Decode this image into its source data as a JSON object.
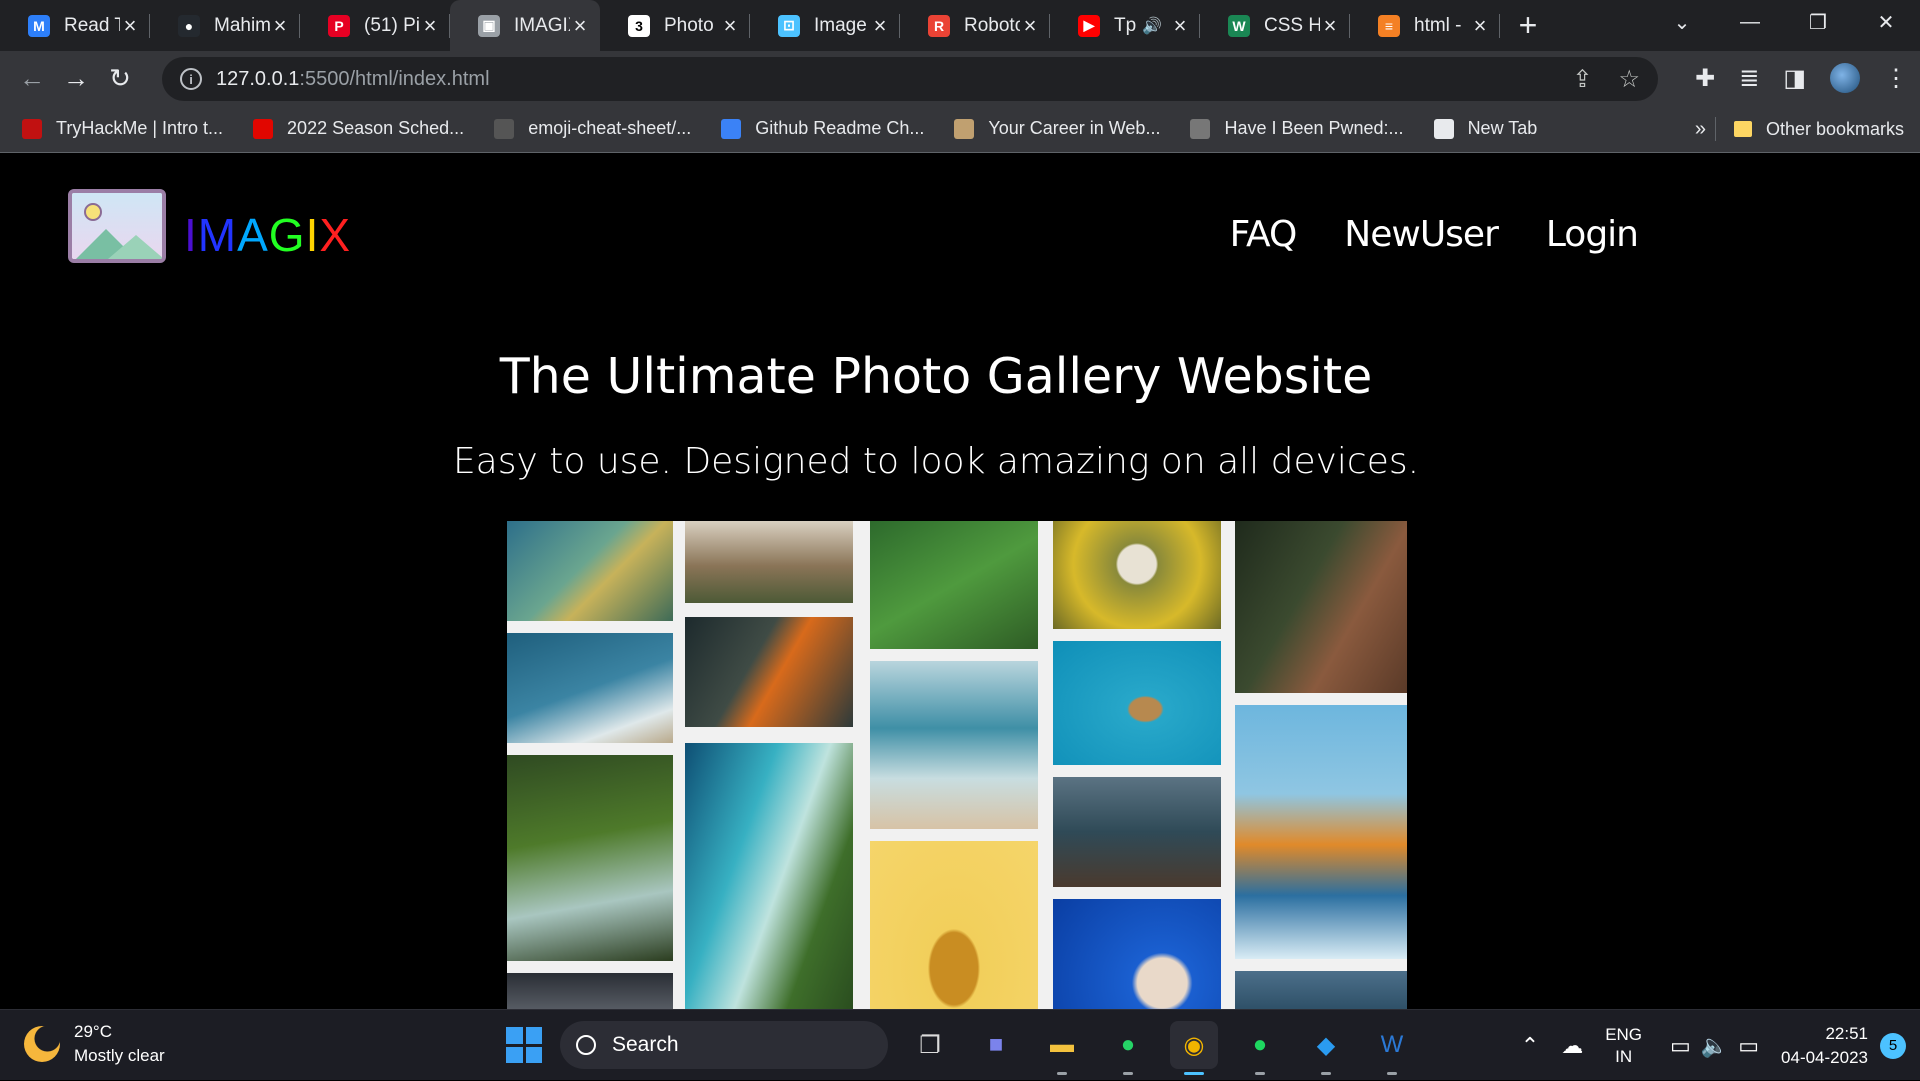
{
  "browser": {
    "tabs": [
      {
        "title": "Read T",
        "favicon": "gmail-icon",
        "color": "#2d7ff9",
        "glyph": "M"
      },
      {
        "title": "Mahim",
        "favicon": "github-icon",
        "color": "#24292f",
        "glyph": "●"
      },
      {
        "title": "(51) Pi",
        "favicon": "pinterest-icon",
        "color": "#e60023",
        "glyph": "P"
      },
      {
        "title": "IMAGIX",
        "favicon": "image-icon",
        "color": "#9aa0a6",
        "glyph": "▣",
        "active": true
      },
      {
        "title": "Photo",
        "favicon": "w3schools-icon",
        "color": "#ffffff",
        "glyph": "3"
      },
      {
        "title": "Image",
        "favicon": "image-frame-icon",
        "color": "#4cc2ff",
        "glyph": "⊡"
      },
      {
        "title": "Roboto",
        "favicon": "google-fonts-icon",
        "color": "#ea4335",
        "glyph": "R"
      },
      {
        "title": "Tp",
        "favicon": "youtube-icon",
        "color": "#ff0000",
        "glyph": "▶",
        "audio": true
      },
      {
        "title": "CSS He",
        "favicon": "css-icon",
        "color": "#1a8754",
        "glyph": "W"
      },
      {
        "title": "html -",
        "favicon": "stackoverflow-icon",
        "color": "#f48024",
        "glyph": "≡"
      }
    ],
    "url_host": "127.0.0.1",
    "url_rest": ":5500/html/index.html",
    "bookmarks": [
      {
        "label": "TryHackMe | Intro t...",
        "icon": "tryhackme-icon",
        "color": "#c11111"
      },
      {
        "label": "2022 Season Sched...",
        "icon": "f1-icon",
        "color": "#e10600"
      },
      {
        "label": "emoji-cheat-sheet/...",
        "icon": "github-icon",
        "color": "#555555"
      },
      {
        "label": "Github Readme Ch...",
        "icon": "infinity-icon",
        "color": "#3b82f6"
      },
      {
        "label": "Your Career in Web...",
        "icon": "deer-icon",
        "color": "#c0a070"
      },
      {
        "label": "Have I Been Pwned:...",
        "icon": "pwned-icon",
        "color": "#777777"
      },
      {
        "label": "New Tab",
        "icon": "globe-icon",
        "color": "#e8eaed"
      }
    ],
    "more_bookmarks": "»",
    "other_bookmarks": "Other bookmarks"
  },
  "site": {
    "brand_letters": [
      "I",
      "M",
      "A",
      "G",
      "I",
      "X"
    ],
    "nav": [
      "FAQ",
      "NewUser",
      "Login"
    ],
    "hero_title": "The Ultimate Photo Gallery Website",
    "hero_subtitle": "Easy to use. Designed to look amazing on all devices."
  },
  "taskbar": {
    "temperature": "29°C",
    "weather": "Mostly clear",
    "search": "Search",
    "lang_1": "ENG",
    "lang_2": "IN",
    "time": "22:51",
    "date": "04-04-2023",
    "notifications": "5"
  }
}
